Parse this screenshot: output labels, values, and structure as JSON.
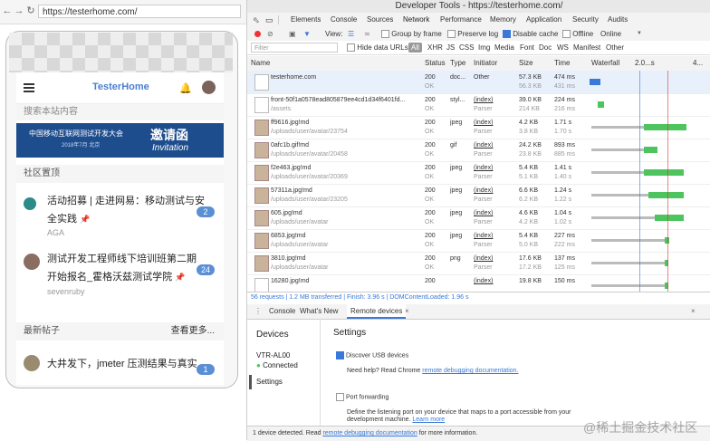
{
  "browser": {
    "url": "https://testerhome.com/"
  },
  "mobile": {
    "brand": "TesterHome",
    "search_placeholder": "搜索本站内容",
    "banner": {
      "title": "中国移动互联网测试开发大会",
      "subtitle": "2018年7月 北京",
      "invitation_cn": "邀请函",
      "invitation_en": "Invitation"
    },
    "section_community": "社区置顶",
    "topics": [
      {
        "title_line1": "活动招募 | 走进网易：移动测试与安",
        "title_line2": "全实践",
        "user": "AGA",
        "count": "2"
      },
      {
        "title_line1": "测试开发工程师线下培训班第二期",
        "title_line2": "开始报名_霍格沃兹测试学院",
        "user": "sevenruby",
        "count": "24"
      }
    ],
    "section_latest": "最新帖子",
    "see_more": "查看更多...",
    "latest": [
      {
        "title": "大井发下，jmeter 压测结果与真实",
        "count": "1"
      }
    ]
  },
  "devtools": {
    "title": "Developer Tools - https://testerhome.com/",
    "tabs": [
      "Elements",
      "Console",
      "Sources",
      "Network",
      "Performance",
      "Memory",
      "Application",
      "Security",
      "Audits"
    ],
    "active_tab": "Network",
    "toolbar": {
      "view": "View:",
      "group_by_frame": "Group by frame",
      "preserve_log": "Preserve log",
      "disable_cache": "Disable cache",
      "offline": "Offline",
      "throttle": "Online"
    },
    "filter": {
      "placeholder": "Filter",
      "hide_data_urls": "Hide data URLs",
      "types": [
        "All",
        "XHR",
        "JS",
        "CSS",
        "Img",
        "Media",
        "Font",
        "Doc",
        "WS",
        "Manifest",
        "Other"
      ]
    },
    "columns": {
      "name": "Name",
      "status": "Status",
      "type": "Type",
      "initiator": "Initiator",
      "size": "Size",
      "time": "Time",
      "waterfall": "Waterfall",
      "wf_tick1": "2.0...s",
      "wf_tick2": "4..."
    },
    "requests": [
      {
        "name": "testerhome.com",
        "path": "",
        "status": "200",
        "status2": "OK",
        "type": "doc...",
        "initiator": "Other",
        "initiator2": "",
        "size": "57.3 KB",
        "size2": "56.3 KB",
        "time": "474 ms",
        "time2": "431 ms",
        "wf_start": 0.0,
        "wf_end": 0.09
      },
      {
        "name": "front-50f1a0578ead805879ee4cd1d34f6401fd...",
        "path": "/assets",
        "status": "200",
        "status2": "OK",
        "type": "styl...",
        "initiator": "(index)",
        "initiator2": "Parser",
        "size": "39.0 KB",
        "size2": "214 KB",
        "time": "224 ms",
        "time2": "216 ms",
        "wf_start": 0.07,
        "wf_end": 0.12
      },
      {
        "name": "ff9616.jpg!md",
        "path": "/uploads/user/avatar/23754",
        "status": "200",
        "status2": "OK",
        "type": "jpeg",
        "initiator": "(index)",
        "initiator2": "Parser",
        "size": "4.2 KB",
        "size2": "3.8 KB",
        "time": "1.71 s",
        "time2": "1.70 s",
        "wf_start": 0.46,
        "wf_end": 0.82
      },
      {
        "name": "0afc1b.gif!md",
        "path": "/uploads/user/avatar/20458",
        "status": "200",
        "status2": "OK",
        "type": "gif",
        "initiator": "(index)",
        "initiator2": "Parser",
        "size": "24.2 KB",
        "size2": "23.8 KB",
        "time": "893 ms",
        "time2": "885 ms",
        "wf_start": 0.46,
        "wf_end": 0.58
      },
      {
        "name": "f2e463.jpg!md",
        "path": "/uploads/user/avatar/20369",
        "status": "200",
        "status2": "OK",
        "type": "jpeg",
        "initiator": "(index)",
        "initiator2": "Parser",
        "size": "5.4 KB",
        "size2": "5.1 KB",
        "time": "1.41 s",
        "time2": "1.40 s",
        "wf_start": 0.46,
        "wf_end": 0.8
      },
      {
        "name": "57311a.jpg!md",
        "path": "/uploads/user/avatar/23205",
        "status": "200",
        "status2": "OK",
        "type": "jpeg",
        "initiator": "(index)",
        "initiator2": "Parser",
        "size": "6.6 KB",
        "size2": "6.2 KB",
        "time": "1.24 s",
        "time2": "1.22 s",
        "wf_start": 0.5,
        "wf_end": 0.8
      },
      {
        "name": "605.jpg!md",
        "path": "/uploads/user/avatar",
        "status": "200",
        "status2": "OK",
        "type": "jpeg",
        "initiator": "(index)",
        "initiator2": "Parser",
        "size": "4.6 KB",
        "size2": "4.2 KB",
        "time": "1.04 s",
        "time2": "1.02 s",
        "wf_start": 0.55,
        "wf_end": 0.8
      },
      {
        "name": "6853.jpg!md",
        "path": "/uploads/user/avatar",
        "status": "200",
        "status2": "OK",
        "type": "jpeg",
        "initiator": "(index)",
        "initiator2": "Parser",
        "size": "5.4 KB",
        "size2": "5.0 KB",
        "time": "227 ms",
        "time2": "222 ms",
        "wf_start": 0.64,
        "wf_end": 0.68
      },
      {
        "name": "3810.jpg!md",
        "path": "/uploads/user/avatar",
        "status": "200",
        "status2": "OK",
        "type": "png",
        "initiator": "(index)",
        "initiator2": "Parser",
        "size": "17.6 KB",
        "size2": "17.2 KB",
        "time": "137 ms",
        "time2": "125 ms",
        "wf_start": 0.64,
        "wf_end": 0.67
      },
      {
        "name": "16280.jpg!md",
        "path": "",
        "status": "200",
        "status2": "",
        "type": "",
        "initiator": "(index)",
        "initiator2": "",
        "size": "19.8 KB",
        "size2": "",
        "time": "150 ms",
        "time2": "",
        "wf_start": 0.64,
        "wf_end": 0.67
      }
    ],
    "summary": "56 requests | 1.2 MB transferred | Finish: 3.96 s | DOMContentLoaded: 1.96 s",
    "drawer_tabs": [
      "Console",
      "What's New",
      "Remote devices"
    ],
    "remote": {
      "devices_heading": "Devices",
      "device_name": "VTR-AL00",
      "device_status": "Connected",
      "settings_nav": "Settings",
      "settings_heading": "Settings",
      "discover_usb": "Discover USB devices",
      "need_help": "Need help? Read Chrome",
      "need_help_link": "remote debugging documentation.",
      "port_forwarding": "Port forwarding",
      "port_desc": "Define the listening port on your device that maps to a port accessible from your development machine.",
      "learn_more": "Learn more"
    },
    "footer": {
      "text": "1 device detected. Read",
      "link": "remote debugging documentation",
      "tail": "for more information."
    }
  },
  "watermark": "@稀土掘金技术社区",
  "colors": {
    "accent": "#3879d9",
    "brand": "#4a7fd0",
    "green": "#4ec45e"
  }
}
